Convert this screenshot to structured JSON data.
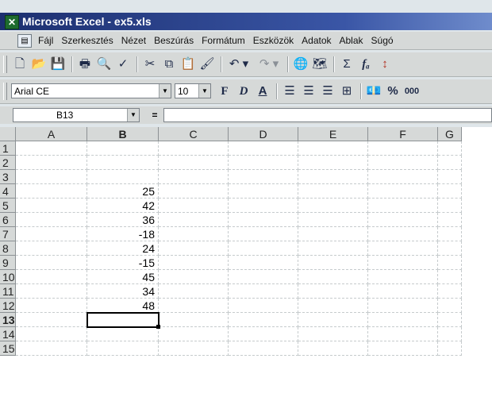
{
  "window": {
    "title": "Microsoft Excel - ex5.xls"
  },
  "menu": [
    "Fájl",
    "Szerkesztés",
    "Nézet",
    "Beszúrás",
    "Formátum",
    "Eszközök",
    "Adatok",
    "Ablak",
    "Súgó"
  ],
  "standard_toolbar": {
    "icons": [
      "new-icon",
      "open-icon",
      "save-icon",
      "print-icon",
      "print-preview-icon",
      "spelling-icon",
      "cut-icon",
      "copy-icon",
      "paste-icon",
      "format-painter-icon",
      "undo-icon",
      "redo-icon",
      "hyperlink-icon",
      "web-toolbar-icon",
      "autosum-icon",
      "function-icon",
      "sort-icon"
    ],
    "autosum": "Σ",
    "function": "fₐ"
  },
  "formatting_toolbar": {
    "font": "Arial CE",
    "size": "10",
    "bold": "F",
    "italic": "D",
    "underline": "A",
    "percent": "%",
    "thousands": "000"
  },
  "formula_bar": {
    "name_box": "B13",
    "equals": "=",
    "content": ""
  },
  "sheet": {
    "columns": [
      "A",
      "B",
      "C",
      "D",
      "E",
      "F",
      "G"
    ],
    "rows": [
      "1",
      "2",
      "3",
      "4",
      "5",
      "6",
      "7",
      "8",
      "9",
      "10",
      "11",
      "12",
      "13",
      "14",
      "15"
    ],
    "b_values": [
      "",
      "",
      "",
      "25",
      "42",
      "36",
      "-18",
      "24",
      "-15",
      "45",
      "34",
      "48",
      "",
      "",
      ""
    ],
    "selected_cell": "B13"
  }
}
